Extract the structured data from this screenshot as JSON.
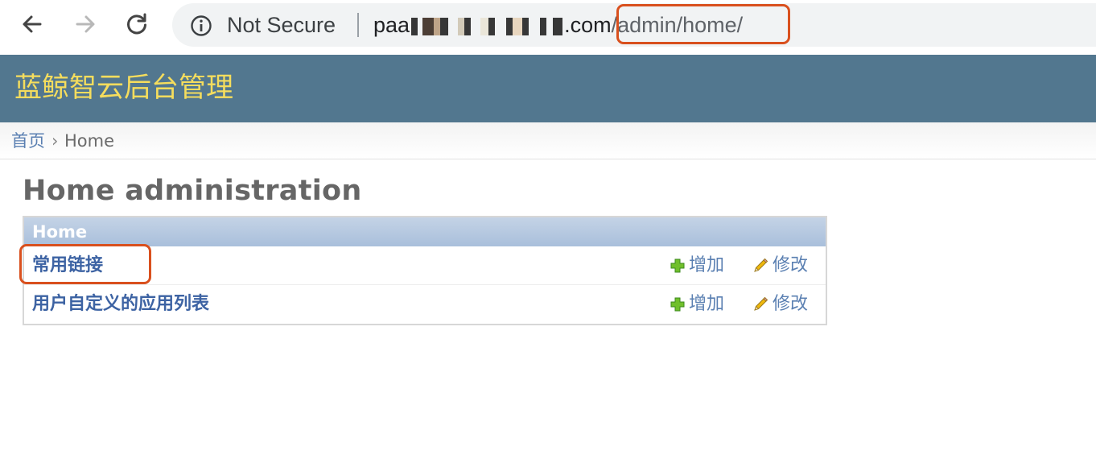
{
  "browser": {
    "security_label": "Not Secure",
    "url_prefix": "paa",
    "url_domain_suffix": ".com",
    "url_path": "/admin/home/",
    "icons": [
      "back-arrow-icon",
      "forward-arrow-icon",
      "reload-icon",
      "info-icon"
    ]
  },
  "header": {
    "site_title": "蓝鲸智云后台管理"
  },
  "breadcrumbs": {
    "home": "首页",
    "separator": "›",
    "current": "Home"
  },
  "page": {
    "title": "Home administration"
  },
  "module": {
    "caption": "Home",
    "rows": [
      {
        "name": "常用链接",
        "add_label": "增加",
        "change_label": "修改"
      },
      {
        "name": "用户自定义的应用列表",
        "add_label": "增加",
        "change_label": "修改"
      }
    ]
  },
  "colors": {
    "header_bg": "#52778f",
    "site_title": "#f5dd5d",
    "link": "#5b80b2",
    "annotation_outline": "#d9501e",
    "caption_bg": "#a9bfdb"
  }
}
